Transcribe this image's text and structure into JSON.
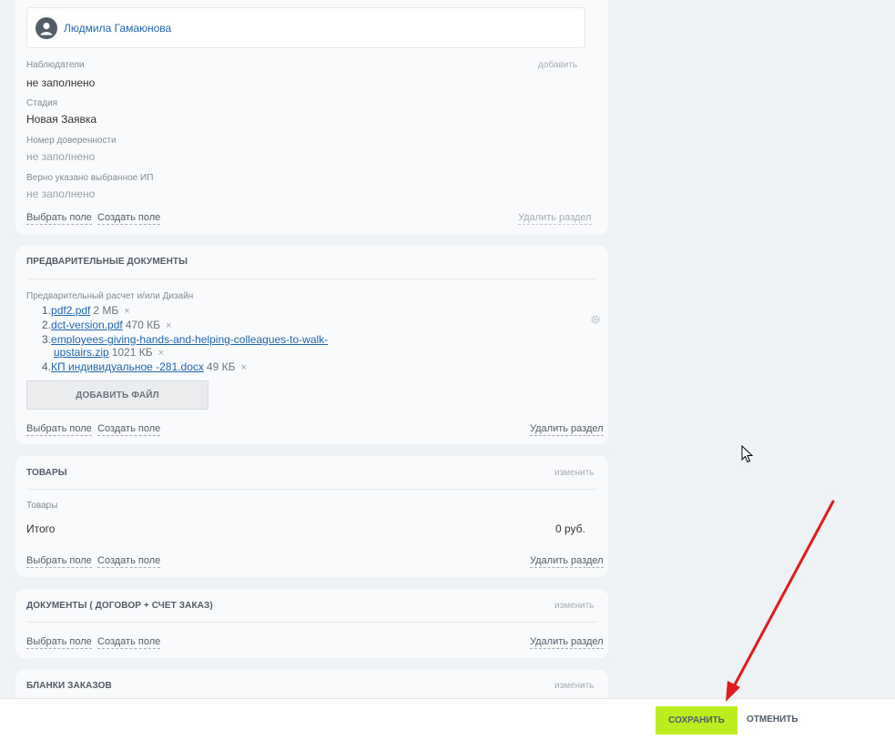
{
  "section1": {
    "responsible": "Людмила Гамаюнова",
    "observers_label": "Наблюдатели",
    "observers_add": "добавить",
    "observers_value": "не заполнено",
    "stage_label": "Стадия",
    "stage_value": "Новая Заявка",
    "poa_label": "Номер доверенности",
    "poa_value": "не заполнено",
    "ip_label": "Верно указано выбранное ИП",
    "ip_value": "не заполнено",
    "choose_field": "Выбрать поле",
    "create_field": "Создать поле",
    "delete_section": "Удалить раздел"
  },
  "prelim_docs": {
    "title": "ПРЕДВАРИТЕЛЬНЫЕ ДОКУМЕНТЫ",
    "field_label": "Предварительный расчет и/или Дизайн",
    "files": [
      {
        "num": "1.",
        "name": "pdf2.pdf",
        "size": "2 МБ"
      },
      {
        "num": "2.",
        "name": "dct-version.pdf",
        "size": "470 КБ"
      },
      {
        "num": "3.",
        "name": "employees-giving-hands-and-helping-colleagues-to-walk-",
        "name2": "upstairs.zip",
        "size": "1021 КБ"
      },
      {
        "num": "4.",
        "name": "КП индивидуальное -281.docx",
        "size": "49 КБ"
      }
    ],
    "remove_glyph": "×",
    "add_file": "ДОБАВИТЬ ФАЙЛ",
    "choose_field": "Выбрать поле",
    "create_field": "Создать поле",
    "delete_section": "Удалить раздел"
  },
  "products": {
    "title": "ТОВАРЫ",
    "edit": "изменить",
    "field_label": "Товары",
    "total_label": "Итого",
    "total_value": "0 руб.",
    "choose_field": "Выбрать поле",
    "create_field": "Создать поле",
    "delete_section": "Удалить раздел"
  },
  "documents": {
    "title": "ДОКУМЕНТЫ ( ДОГОВОР + СЧЕТ ЗАКАЗ)",
    "edit": "изменить",
    "choose_field": "Выбрать поле",
    "create_field": "Создать поле",
    "delete_section": "Удалить раздел"
  },
  "order_forms": {
    "title": "БЛАНКИ ЗАКАЗОВ",
    "edit": "изменить"
  },
  "footer": {
    "save": "СОХРАНИТЬ",
    "cancel": "ОТМЕНИТЬ"
  },
  "icons": [
    "user-avatar-icon",
    "gear-icon",
    "close-icon",
    "mouse-cursor-icon",
    "red-arrow-annotation"
  ],
  "colors": {
    "accent_save": "#bbed21",
    "link_blue": "#2067b0",
    "annotation_red": "#e01b1b"
  }
}
